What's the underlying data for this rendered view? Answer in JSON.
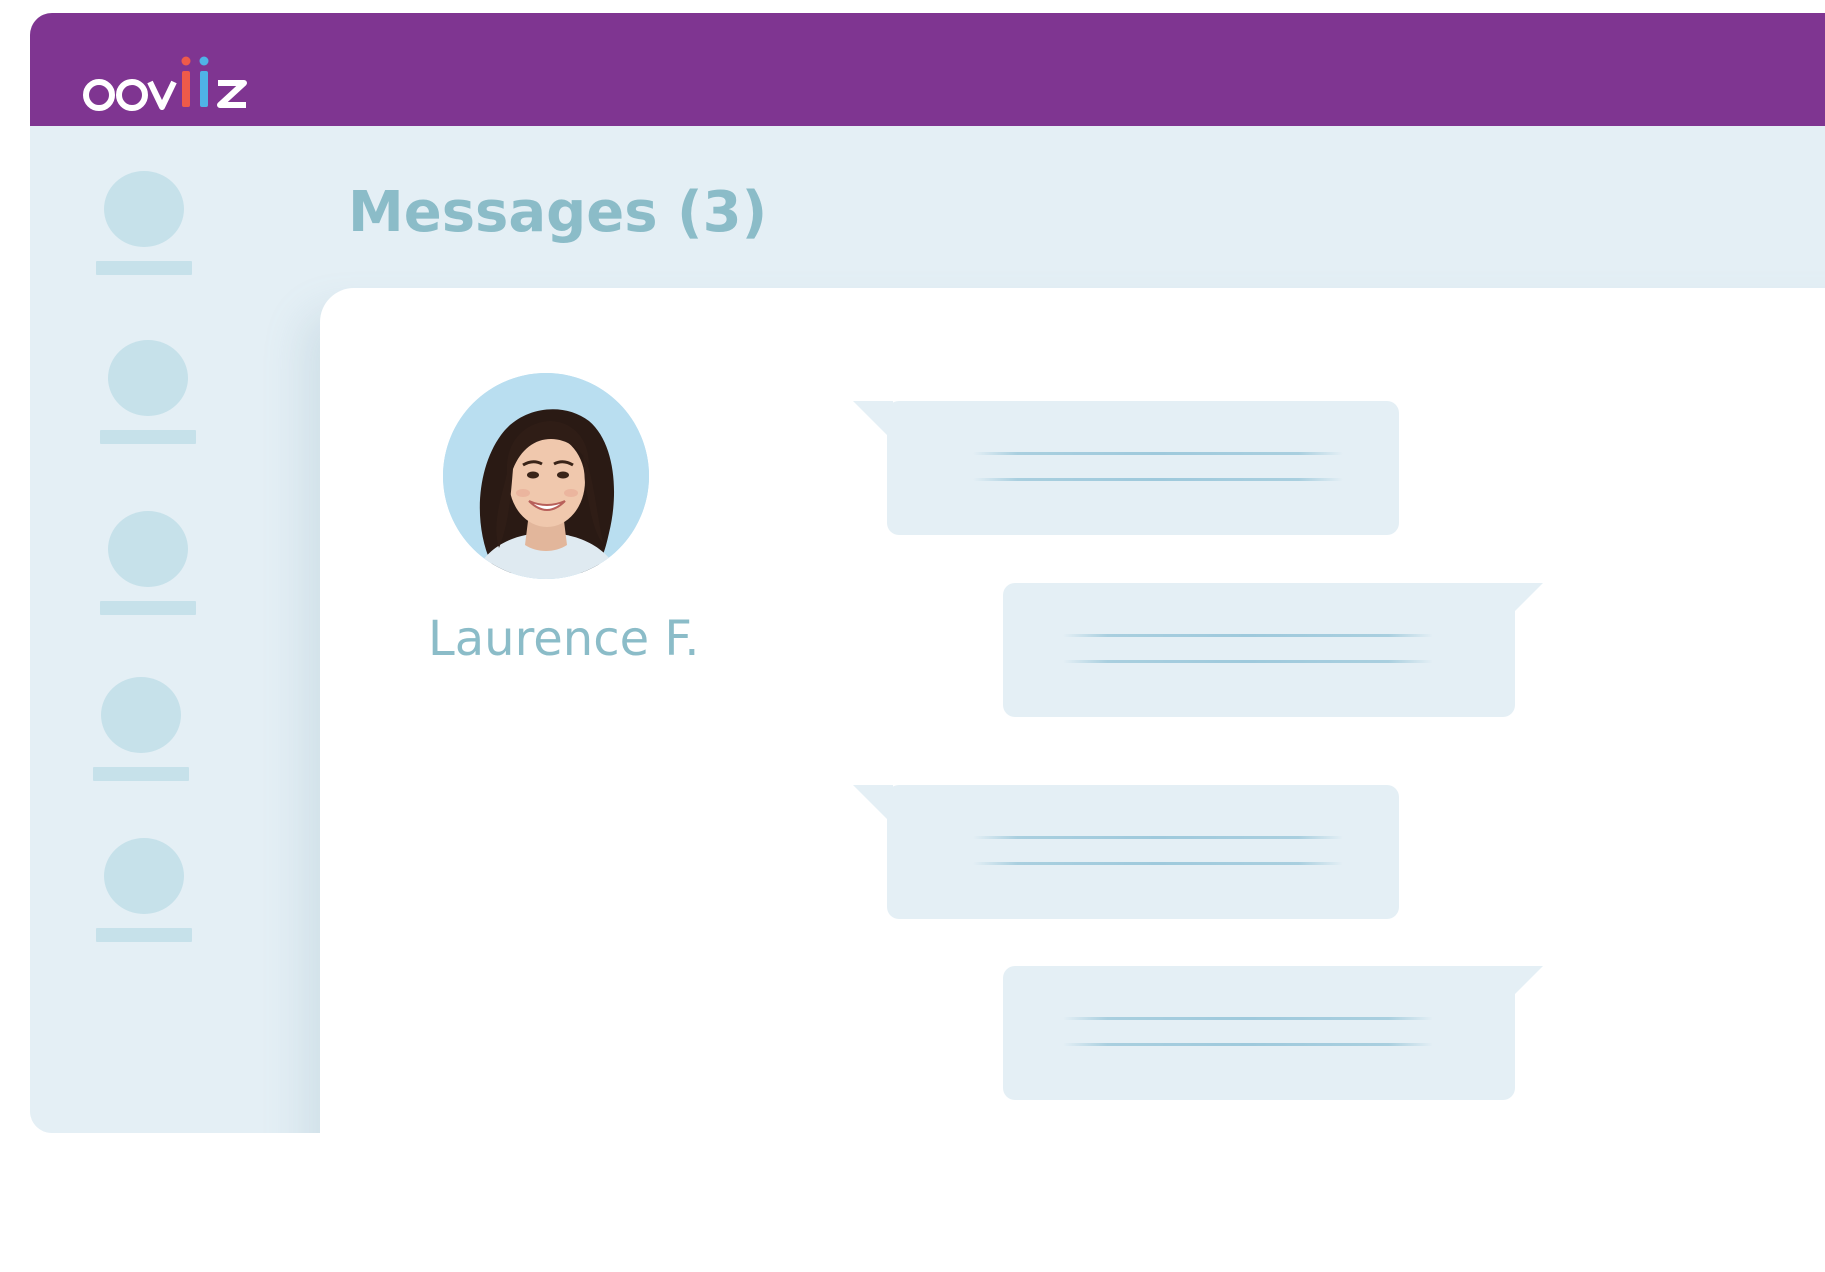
{
  "app": {
    "logo_text": "ooviiz",
    "brand_color": "#7f3591",
    "logo_accent_colors": [
      "#ee5a4a",
      "#4fb3e6"
    ]
  },
  "main": {
    "title": "Messages (3)"
  },
  "sidebar": {
    "items": [
      {
        "icon": "placeholder-circle-icon"
      },
      {
        "icon": "placeholder-circle-icon"
      },
      {
        "icon": "placeholder-circle-icon"
      },
      {
        "icon": "placeholder-circle-icon"
      },
      {
        "icon": "placeholder-circle-icon"
      }
    ]
  },
  "conversation": {
    "contact": {
      "name": "Laurence F.",
      "avatar": "woman-portrait-avatar"
    },
    "messages": [
      {
        "side": "left"
      },
      {
        "side": "right"
      },
      {
        "side": "left"
      },
      {
        "side": "right"
      }
    ]
  }
}
